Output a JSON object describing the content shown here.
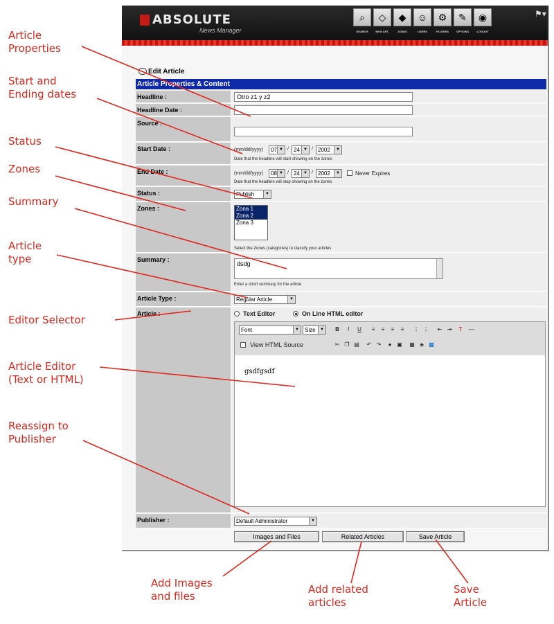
{
  "annotations": [
    {
      "id": "article-properties",
      "lines": [
        "Article",
        "Properties"
      ]
    },
    {
      "id": "start-ending-dates",
      "lines": [
        "Start and",
        "Ending dates"
      ]
    },
    {
      "id": "status",
      "lines": [
        "Status"
      ]
    },
    {
      "id": "zones",
      "lines": [
        "Zones"
      ]
    },
    {
      "id": "summary",
      "lines": [
        "Summary"
      ]
    },
    {
      "id": "article-type",
      "lines": [
        "Article",
        "type"
      ]
    },
    {
      "id": "editor-selector",
      "lines": [
        "Editor Selector"
      ]
    },
    {
      "id": "article-editor",
      "lines": [
        "Article Editor",
        "(Text or HTML)"
      ]
    },
    {
      "id": "reassign",
      "lines": [
        "Reassign to",
        "Publisher"
      ]
    },
    {
      "id": "add-images",
      "lines": [
        "Add Images",
        "and files"
      ]
    },
    {
      "id": "add-related",
      "lines": [
        "Add related",
        "articles"
      ]
    },
    {
      "id": "save-article",
      "lines": [
        "Save",
        "Article"
      ]
    }
  ],
  "colors": {
    "annotation": "#e0261c",
    "header_band": "#0f2aa8",
    "label_cell": "#c8c8c8",
    "top_bar": "#1a1a1a",
    "red_strip": "#cc1111"
  },
  "app": {
    "logo_text": "ABSOLUTE",
    "logo_sub": "News Manager",
    "toolbar": [
      {
        "label": "SEARCH",
        "icon": "search-icon"
      },
      {
        "label": "NEW ART.",
        "icon": "new-article-icon"
      },
      {
        "label": "ZONES",
        "icon": "zones-icon"
      },
      {
        "label": "USERS",
        "icon": "users-icon"
      },
      {
        "label": "PLUGINS",
        "icon": "plugins-icon"
      },
      {
        "label": "OPTIONS",
        "icon": "options-icon"
      },
      {
        "label": "LOGOUT",
        "icon": "logout-icon"
      }
    ],
    "breadcrumb": "Edit Article",
    "section_title": "Article Properties & Content"
  },
  "form": {
    "headline": {
      "label": "Headline :",
      "value": "Otro z1 y z2"
    },
    "headline_date": {
      "label": "Headline Date :",
      "value": ""
    },
    "source": {
      "label": "Source :",
      "value": ""
    },
    "start_date": {
      "label": "Start Date :",
      "format": "(mm/dd/yyyy)",
      "month": "07",
      "day": "24",
      "year": "2002",
      "sep": "/",
      "help": "Date that the headline will start showing on the zones"
    },
    "end_date": {
      "label": "End Date :",
      "format": "(mm/dd/yyyy)",
      "month": "08",
      "day": "24",
      "year": "2002",
      "sep": "/",
      "never_expires": "Never Expires",
      "help": "Date that the headline will stop showing on the zones"
    },
    "status": {
      "label": "Status :",
      "value": "Publish"
    },
    "zones": {
      "label": "Zones :",
      "options": [
        "Zona 1",
        "Zona 2",
        "Zona 3"
      ],
      "selected": [
        "Zona 1",
        "Zona 2"
      ],
      "help": "Select the Zones (categories) to classify your articles"
    },
    "summary": {
      "label": "Summary :",
      "value": "dsdg",
      "help": "Enter a short summary for the article"
    },
    "article_type": {
      "label": "Article Type :",
      "value": "Regular Article"
    },
    "article": {
      "label": "Article :",
      "editor_options": [
        "Text Editor",
        "On Line HTML editor"
      ],
      "selected_editor": "On Line HTML editor",
      "font": "Font",
      "size": "Size",
      "view_source": "View HTML Source",
      "content": "gsdfgsdf"
    },
    "publisher": {
      "label": "Publisher :",
      "value": "Default Administrator"
    }
  },
  "buttons": {
    "images": "Images and Files",
    "related": "Related Articles",
    "save": "Save Article"
  }
}
